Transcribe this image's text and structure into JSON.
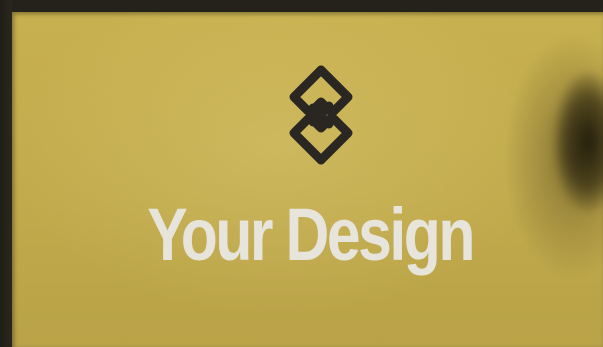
{
  "headline": "Your Design",
  "logo": {
    "icon": "interlocking-links-icon",
    "color": "#2a2723"
  },
  "colors": {
    "panel": "#c4ad4e",
    "headline": "#e7e4dc",
    "background": "#222019"
  }
}
